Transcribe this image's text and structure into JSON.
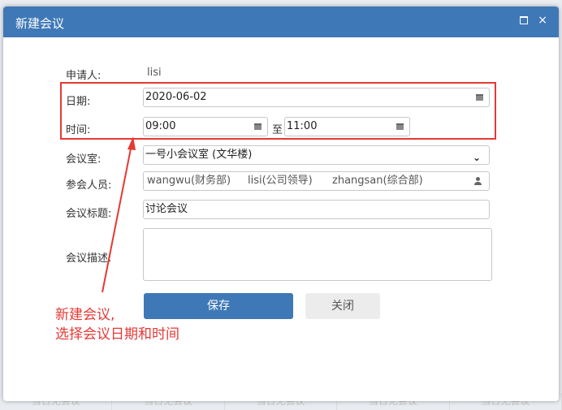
{
  "background": {
    "cells": [
      "当日无会议",
      "当日无会议",
      "当日无会议",
      "当日无会议",
      "当日无会议"
    ]
  },
  "dialog": {
    "title": "新建会议",
    "applicant": {
      "label": "申请人:",
      "value": "lisi"
    },
    "date": {
      "label": "日期:",
      "value": "2020-06-02"
    },
    "time": {
      "label": "时间:",
      "start": "09:00",
      "separator": "至",
      "end": "11:00"
    },
    "room": {
      "label": "会议室:",
      "value": "一号小会议室 (文华楼)"
    },
    "participants": {
      "label": "参会人员:",
      "items": [
        "wangwu(财务部)",
        "lisi(公司领导)",
        "zhangsan(综合部)"
      ]
    },
    "subject": {
      "label": "会议标题:",
      "value": "讨论会议"
    },
    "description": {
      "label": "会议描述:",
      "value": ""
    },
    "save_label": "保存",
    "close_label": "关闭"
  },
  "annotation": {
    "line1": "新建会议,",
    "line2": "选择会议日期和时间"
  },
  "colors": {
    "primary": "#3f78b6",
    "annotation": "#e53935"
  }
}
